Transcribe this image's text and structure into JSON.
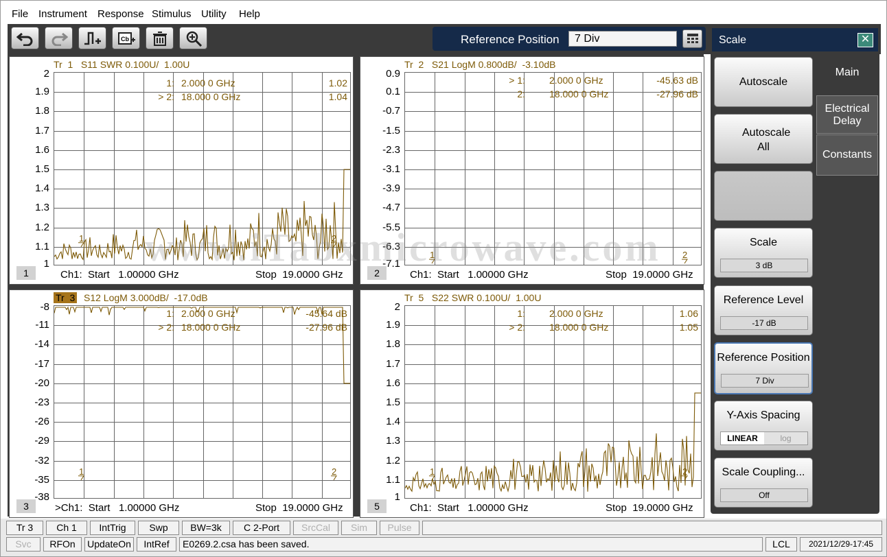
{
  "menu": [
    "File",
    "Instrument",
    "Response",
    "Stimulus",
    "Utility",
    "Help"
  ],
  "toolbar": {
    "icons": [
      "undo-icon",
      "redo-icon",
      "add-marker-icon",
      "copy-to-clipboard-icon",
      "delete-trace-icon",
      "zoom-icon"
    ],
    "reference_position_label": "Reference Position",
    "reference_position_value": "7 Div"
  },
  "watermark": "www.iTabxmicrowave.com",
  "traces": [
    {
      "title": "Tr  1   S11 SWR 0.100U/  1.00U",
      "yticks": [
        "2",
        "1.9",
        "1.8",
        "1.7",
        "1.6",
        "1.5",
        "1.4",
        "1.3",
        "1.2",
        "1.1",
        "1"
      ],
      "markers": [
        {
          "id": "1:",
          "freq": "2.000 0 GHz",
          "value": "1.02"
        },
        {
          "id": "> 2:",
          "freq": "18.000 0 GHz",
          "value": "1.04"
        }
      ],
      "channel": "1",
      "start": "Ch1:  Start   1.00000 GHz",
      "stop": "Stop  19.0000 GHz"
    },
    {
      "title": "Tr  2   S21 LogM 0.800dB/  -3.10dB",
      "yticks": [
        "0.9",
        "0.1",
        "-0.7",
        "-1.5",
        "-2.3",
        "-3.1",
        "-3.9",
        "-4.7",
        "-5.5",
        "-6.3",
        "-7.1"
      ],
      "markers": [
        {
          "id": "> 1:",
          "freq": "2.000 0 GHz",
          "value": "-45.63 dB"
        },
        {
          "id": "2:",
          "freq": "18.000 0 GHz",
          "value": "-27.96 dB"
        }
      ],
      "channel": "2",
      "start": "Ch1:  Start   1.00000 GHz",
      "stop": "Stop  19.0000 GHz"
    },
    {
      "title_tag": "Tr  3",
      "title": "S12 LogM 3.000dB/  -17.0dB",
      "yticks": [
        "-8",
        "-11",
        "-14",
        "-17",
        "-20",
        "-23",
        "-26",
        "-29",
        "-32",
        "-35",
        "-38"
      ],
      "markers": [
        {
          "id": "1:",
          "freq": "2.000 0 GHz",
          "value": "-45.64 dB"
        },
        {
          "id": "> 2:",
          "freq": "18.000 0 GHz",
          "value": "-27.96 dB"
        }
      ],
      "channel": "3",
      "start": ">Ch1:  Start   1.00000 GHz",
      "stop": "Stop  19.0000 GHz"
    },
    {
      "title": "Tr  5   S22 SWR 0.100U/  1.00U",
      "yticks": [
        "2",
        "1.9",
        "1.8",
        "1.7",
        "1.6",
        "1.5",
        "1.4",
        "1.3",
        "1.2",
        "1.1",
        "1"
      ],
      "markers": [
        {
          "id": "1:",
          "freq": "2.000 0 GHz",
          "value": "1.06"
        },
        {
          "id": "> 2:",
          "freq": "18.000 0 GHz",
          "value": "1.05"
        }
      ],
      "channel": "5",
      "start": "Ch1:  Start   1.00000 GHz",
      "stop": "Stop  19.0000 GHz"
    }
  ],
  "side": {
    "title": "Scale",
    "tabs": [
      "Main",
      "Electrical Delay",
      "Constants"
    ],
    "autoscale": "Autoscale",
    "autoscale_all": "Autoscale All",
    "scale_label": "Scale",
    "scale_value": "3 dB",
    "ref_level_label": "Reference Level",
    "ref_level_value": "-17 dB",
    "ref_pos_label": "Reference Position",
    "ref_pos_value": "7 Div",
    "yspacing_label": "Y-Axis Spacing",
    "yspacing_linear": "LINEAR",
    "yspacing_log": "log",
    "coupling_label": "Scale Coupling...",
    "coupling_value": "Off"
  },
  "status": {
    "row1": [
      "Tr 3",
      "Ch 1",
      "IntTrig",
      "Swp",
      "BW=3k",
      "C  2-Port",
      "SrcCal",
      "Sim",
      "Pulse"
    ],
    "row2": [
      "Svc",
      "RFOn",
      "UpdateOn",
      "IntRef"
    ],
    "message": "E0269.2.csa has been saved.",
    "lcl": "LCL",
    "datetime": "2021/12/29-17:45"
  },
  "colors": {
    "trace": "#7d5a07",
    "panel_title": "#152a49",
    "toolbar": "#3a3a3a",
    "tag_bg": "#a6741a"
  }
}
